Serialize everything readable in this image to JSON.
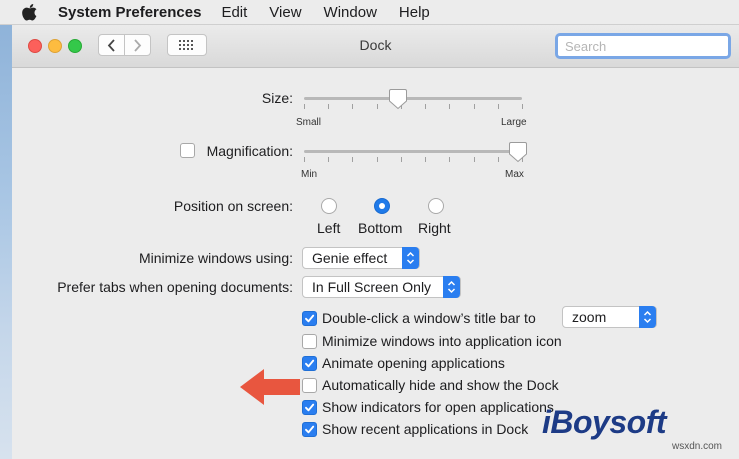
{
  "menubar": {
    "app_name": "System Preferences",
    "items": [
      "Edit",
      "View",
      "Window",
      "Help"
    ]
  },
  "window": {
    "title": "Dock",
    "search_placeholder": "Search"
  },
  "size": {
    "label": "Size:",
    "min_label": "Small",
    "max_label": "Large",
    "value_fraction": 0.43
  },
  "magnification": {
    "label": "Magnification:",
    "checked": false,
    "min_label": "Min",
    "max_label": "Max",
    "value_fraction": 0.98
  },
  "position": {
    "label": "Position on screen:",
    "options": [
      "Left",
      "Bottom",
      "Right"
    ],
    "selected": "Bottom"
  },
  "minimize": {
    "label": "Minimize windows using:",
    "value": "Genie effect"
  },
  "prefer_tabs": {
    "label": "Prefer tabs when opening documents:",
    "value": "In Full Screen Only"
  },
  "options": {
    "double_click": {
      "label": "Double-click a window’s title bar to",
      "checked": true,
      "action": "zoom"
    },
    "minimize_into_icon": {
      "label": "Minimize windows into application icon",
      "checked": false
    },
    "animate": {
      "label": "Animate opening applications",
      "checked": true
    },
    "autohide": {
      "label": "Automatically hide and show the Dock",
      "checked": false
    },
    "indicators": {
      "label": "Show indicators for open applications",
      "checked": true
    },
    "recent": {
      "label": "Show recent applications in Dock",
      "checked": true
    }
  },
  "colors": {
    "accent": "#2a7ef0",
    "annotation_arrow": "#e8563f",
    "watermark": "#1d3b86"
  },
  "watermark": {
    "brand": "iBoysoft",
    "domain": "wsxdn.com"
  }
}
